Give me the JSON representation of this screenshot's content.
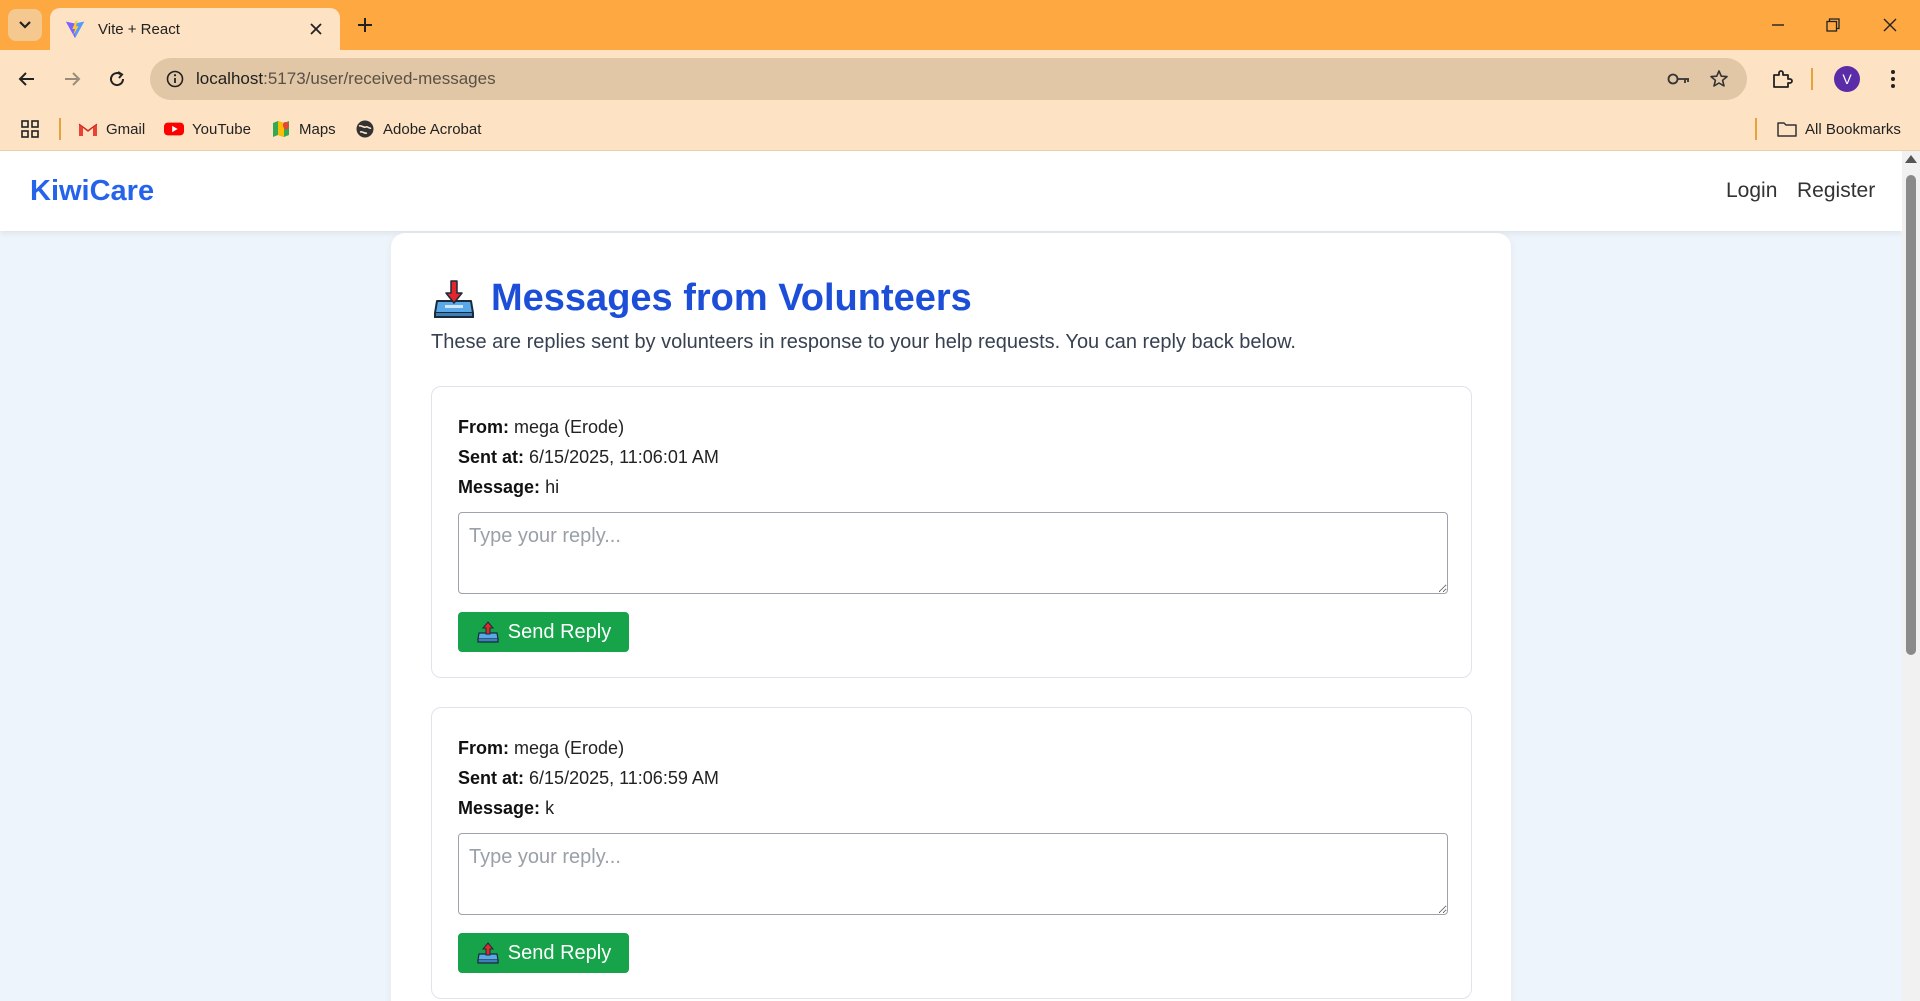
{
  "browser": {
    "tab_title": "Vite + React",
    "url_host": "localhost",
    "url_path": ":5173/user/received-messages",
    "profile_initial": "V",
    "bookmarks": [
      {
        "label": "Gmail",
        "icon": "gmail-icon"
      },
      {
        "label": "YouTube",
        "icon": "youtube-icon"
      },
      {
        "label": "Maps",
        "icon": "maps-icon"
      },
      {
        "label": "Adobe Acrobat",
        "icon": "globe-icon"
      }
    ],
    "all_bookmarks": "All Bookmarks",
    "colors": {
      "frame": "#fea842",
      "toolbar": "#fde3c4"
    }
  },
  "navbar": {
    "brand": "KiwiCare",
    "login": "Login",
    "register": "Register"
  },
  "page": {
    "title": "Messages from Volunteers",
    "subtitle": "These are replies sent by volunteers in response to your help requests. You can reply back below.",
    "labels": {
      "from": "From:",
      "sent_at": "Sent at:",
      "message": "Message:"
    },
    "reply_placeholder": "Type your reply...",
    "send_label": "Send Reply",
    "messages": [
      {
        "from": "mega (Erode)",
        "sent_at": "6/15/2025, 11:06:01 AM",
        "message": "hi"
      },
      {
        "from": "mega (Erode)",
        "sent_at": "6/15/2025, 11:06:59 AM",
        "message": "k"
      }
    ]
  },
  "colors": {
    "brand": "#2563eb",
    "heading": "#1d4ed8",
    "send_button": "#16a34a",
    "page_bg": "#eef4fb"
  }
}
